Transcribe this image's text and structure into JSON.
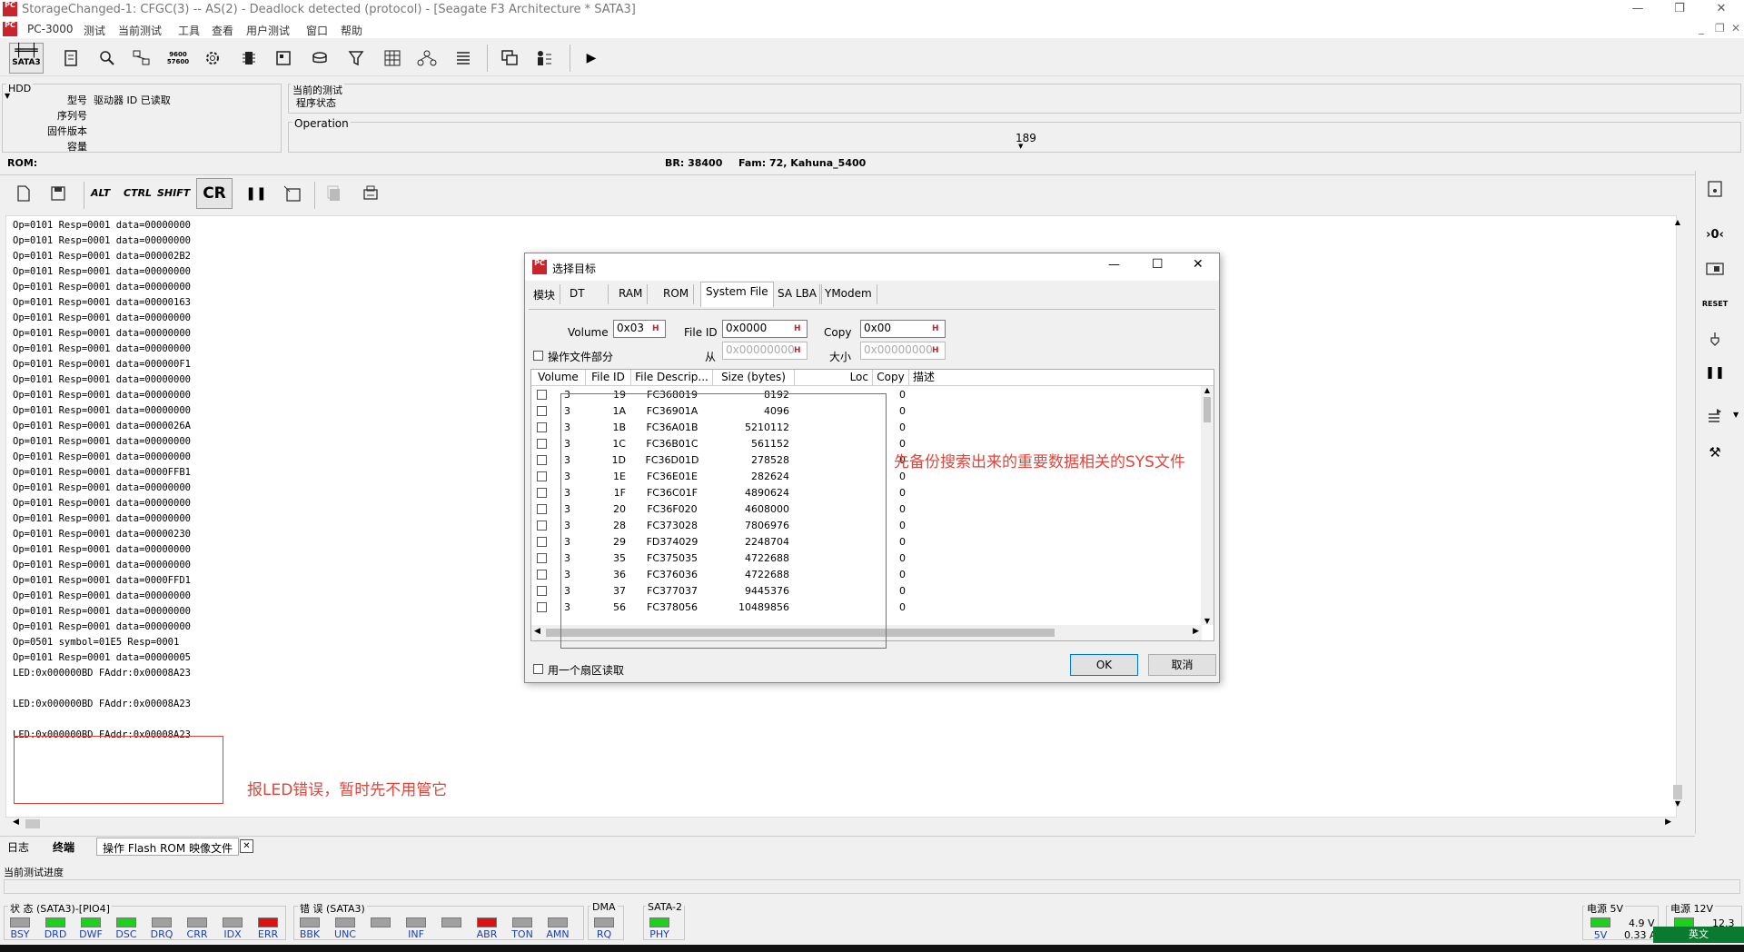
{
  "window": {
    "title": "StorageChanged-1: CFGC(3) -- AS(2) - Deadlock detected (protocol) - [Seagate F3 Architecture * SATA3]",
    "logo": "PC"
  },
  "menu": [
    "PC-3000",
    "测试",
    "当前测试",
    "工具",
    "查看",
    "用户测试",
    "窗口",
    "帮助"
  ],
  "toolbar": {
    "sata_label": "SATA3",
    "rate_label": "9600 57600"
  },
  "hdd": {
    "title": "HDD",
    "fields": [
      {
        "label": "型号",
        "value": "驱动器 ID 已读取"
      },
      {
        "label": "序列号",
        "value": ""
      },
      {
        "label": "固件版本",
        "value": ""
      },
      {
        "label": "容量",
        "value": ""
      }
    ]
  },
  "current_test": {
    "title": "当前的测试",
    "status": "程序状态"
  },
  "operation": {
    "title": "Operation",
    "value": "189"
  },
  "rom_bar": {
    "rom": "ROM:",
    "br": "BR: 38400",
    "fam": "Fam: 72, Kahuna_5400"
  },
  "terminal_toolbar": {
    "alt": "ALT",
    "ctrl": "CTRL",
    "shift": "SHIFT",
    "cr": "CR"
  },
  "terminal_lines": [
    "Op=0101 Resp=0001 data=00000000",
    "Op=0101 Resp=0001 data=00000000",
    "Op=0101 Resp=0001 data=000002B2",
    "Op=0101 Resp=0001 data=00000000",
    "Op=0101 Resp=0001 data=00000000",
    "Op=0101 Resp=0001 data=00000163",
    "Op=0101 Resp=0001 data=00000000",
    "Op=0101 Resp=0001 data=00000000",
    "Op=0101 Resp=0001 data=00000000",
    "Op=0101 Resp=0001 data=000000F1",
    "Op=0101 Resp=0001 data=00000000",
    "Op=0101 Resp=0001 data=00000000",
    "Op=0101 Resp=0001 data=00000000",
    "Op=0101 Resp=0001 data=0000026A",
    "Op=0101 Resp=0001 data=00000000",
    "Op=0101 Resp=0001 data=00000000",
    "Op=0101 Resp=0001 data=0000FFB1",
    "Op=0101 Resp=0001 data=00000000",
    "Op=0101 Resp=0001 data=00000000",
    "Op=0101 Resp=0001 data=00000000",
    "Op=0101 Resp=0001 data=00000230",
    "Op=0101 Resp=0001 data=00000000",
    "Op=0101 Resp=0001 data=00000000",
    "Op=0101 Resp=0001 data=0000FFD1",
    "Op=0101 Resp=0001 data=00000000",
    "Op=0101 Resp=0001 data=00000000",
    "Op=0101 Resp=0001 data=00000000",
    "Op=0501 symbol=01E5 Resp=0001",
    "Op=0101 Resp=0001 data=00000005",
    "LED:0x000000BD FAddr:0x00008A23",
    "",
    "LED:0x000000BD FAddr:0x00008A23",
    "",
    "LED:0x000000BD FAddr:0x00008A23"
  ],
  "annotation_led": "报LED错误，暂时先不用管它",
  "annotation_sys": "先备份搜索出来的重要数据相关的SYS文件",
  "bottom_tabs": [
    "日志",
    "终端",
    "操作 Flash ROM 映像文件"
  ],
  "progress_label": "当前测试进度",
  "status_groups": {
    "state": {
      "title": "状 态 (SATA3)-[PIO4]",
      "leds": [
        {
          "label": "BSY",
          "color": "#a0a0a0"
        },
        {
          "label": "DRD",
          "color": "#19d219"
        },
        {
          "label": "DWF",
          "color": "#19d219"
        },
        {
          "label": "DSC",
          "color": "#19d219"
        },
        {
          "label": "DRQ",
          "color": "#a0a0a0"
        },
        {
          "label": "CRR",
          "color": "#a0a0a0"
        },
        {
          "label": "IDX",
          "color": "#a0a0a0"
        },
        {
          "label": "ERR",
          "color": "#e01010"
        }
      ]
    },
    "error": {
      "title": "错 误 (SATA3)",
      "leds": [
        {
          "label": "BBK",
          "color": "#a0a0a0"
        },
        {
          "label": "UNC",
          "color": "#a0a0a0"
        },
        {
          "label": "",
          "color": "#a0a0a0"
        },
        {
          "label": "INF",
          "color": "#a0a0a0"
        },
        {
          "label": "",
          "color": "#a0a0a0"
        },
        {
          "label": "ABR",
          "color": "#e01010"
        },
        {
          "label": "TON",
          "color": "#a0a0a0"
        },
        {
          "label": "AMN",
          "color": "#a0a0a0"
        }
      ]
    },
    "dma": {
      "title": "DMA",
      "leds": [
        {
          "label": "RQ",
          "color": "#a0a0a0"
        }
      ]
    },
    "sata2": {
      "title": "SATA-2",
      "leds": [
        {
          "label": "PHY",
          "color": "#19d219"
        }
      ]
    }
  },
  "power5": {
    "title": "电源 5V",
    "label": "5V",
    "voltage": "4.9 V",
    "current": "0.33 A"
  },
  "power12": {
    "title": "电源 12V",
    "voltage": "12.3 V",
    "ime": "英文"
  },
  "dialog": {
    "title": "选择目标",
    "tabs": [
      "模块",
      "DT",
      "RAM",
      "ROM",
      "System File",
      "SA LBA",
      "YModem"
    ],
    "active_tab": "System File",
    "volume_label": "Volume",
    "volume_value": "0x03",
    "fileid_label": "File ID",
    "fileid_value": "0x0000",
    "copy_label": "Copy",
    "copy_value": "0x00",
    "part_label": "操作文件部分",
    "from_label": "从",
    "from_value": "0x00000000",
    "size_label": "大小",
    "size_value": "0x00000000",
    "columns": [
      "Volume",
      "File ID",
      "File Descrip...",
      "Size (bytes)",
      "Loc",
      "Copy",
      "描述"
    ],
    "rows": [
      {
        "vol": "3",
        "id": "19",
        "desc": "FC368019",
        "size": "8192",
        "copy": "0"
      },
      {
        "vol": "3",
        "id": "1A",
        "desc": "FC36901A",
        "size": "4096",
        "copy": "0"
      },
      {
        "vol": "3",
        "id": "1B",
        "desc": "FC36A01B",
        "size": "5210112",
        "copy": "0"
      },
      {
        "vol": "3",
        "id": "1C",
        "desc": "FC36B01C",
        "size": "561152",
        "copy": "0"
      },
      {
        "vol": "3",
        "id": "1D",
        "desc": "FC36D01D",
        "size": "278528",
        "copy": "0"
      },
      {
        "vol": "3",
        "id": "1E",
        "desc": "FC36E01E",
        "size": "282624",
        "copy": "0"
      },
      {
        "vol": "3",
        "id": "1F",
        "desc": "FC36C01F",
        "size": "4890624",
        "copy": "0"
      },
      {
        "vol": "3",
        "id": "20",
        "desc": "FC36F020",
        "size": "4608000",
        "copy": "0"
      },
      {
        "vol": "3",
        "id": "28",
        "desc": "FC373028",
        "size": "7806976",
        "copy": "0"
      },
      {
        "vol": "3",
        "id": "29",
        "desc": "FD374029",
        "size": "2248704",
        "copy": "0"
      },
      {
        "vol": "3",
        "id": "35",
        "desc": "FC375035",
        "size": "4722688",
        "copy": "0"
      },
      {
        "vol": "3",
        "id": "36",
        "desc": "FC376036",
        "size": "4722688",
        "copy": "0"
      },
      {
        "vol": "3",
        "id": "37",
        "desc": "FC377037",
        "size": "9445376",
        "copy": "0"
      },
      {
        "vol": "3",
        "id": "56",
        "desc": "FC378056",
        "size": "10489856",
        "copy": "0"
      }
    ],
    "single_sector_label": "用一个扇区读取",
    "ok": "OK",
    "cancel": "取消"
  }
}
